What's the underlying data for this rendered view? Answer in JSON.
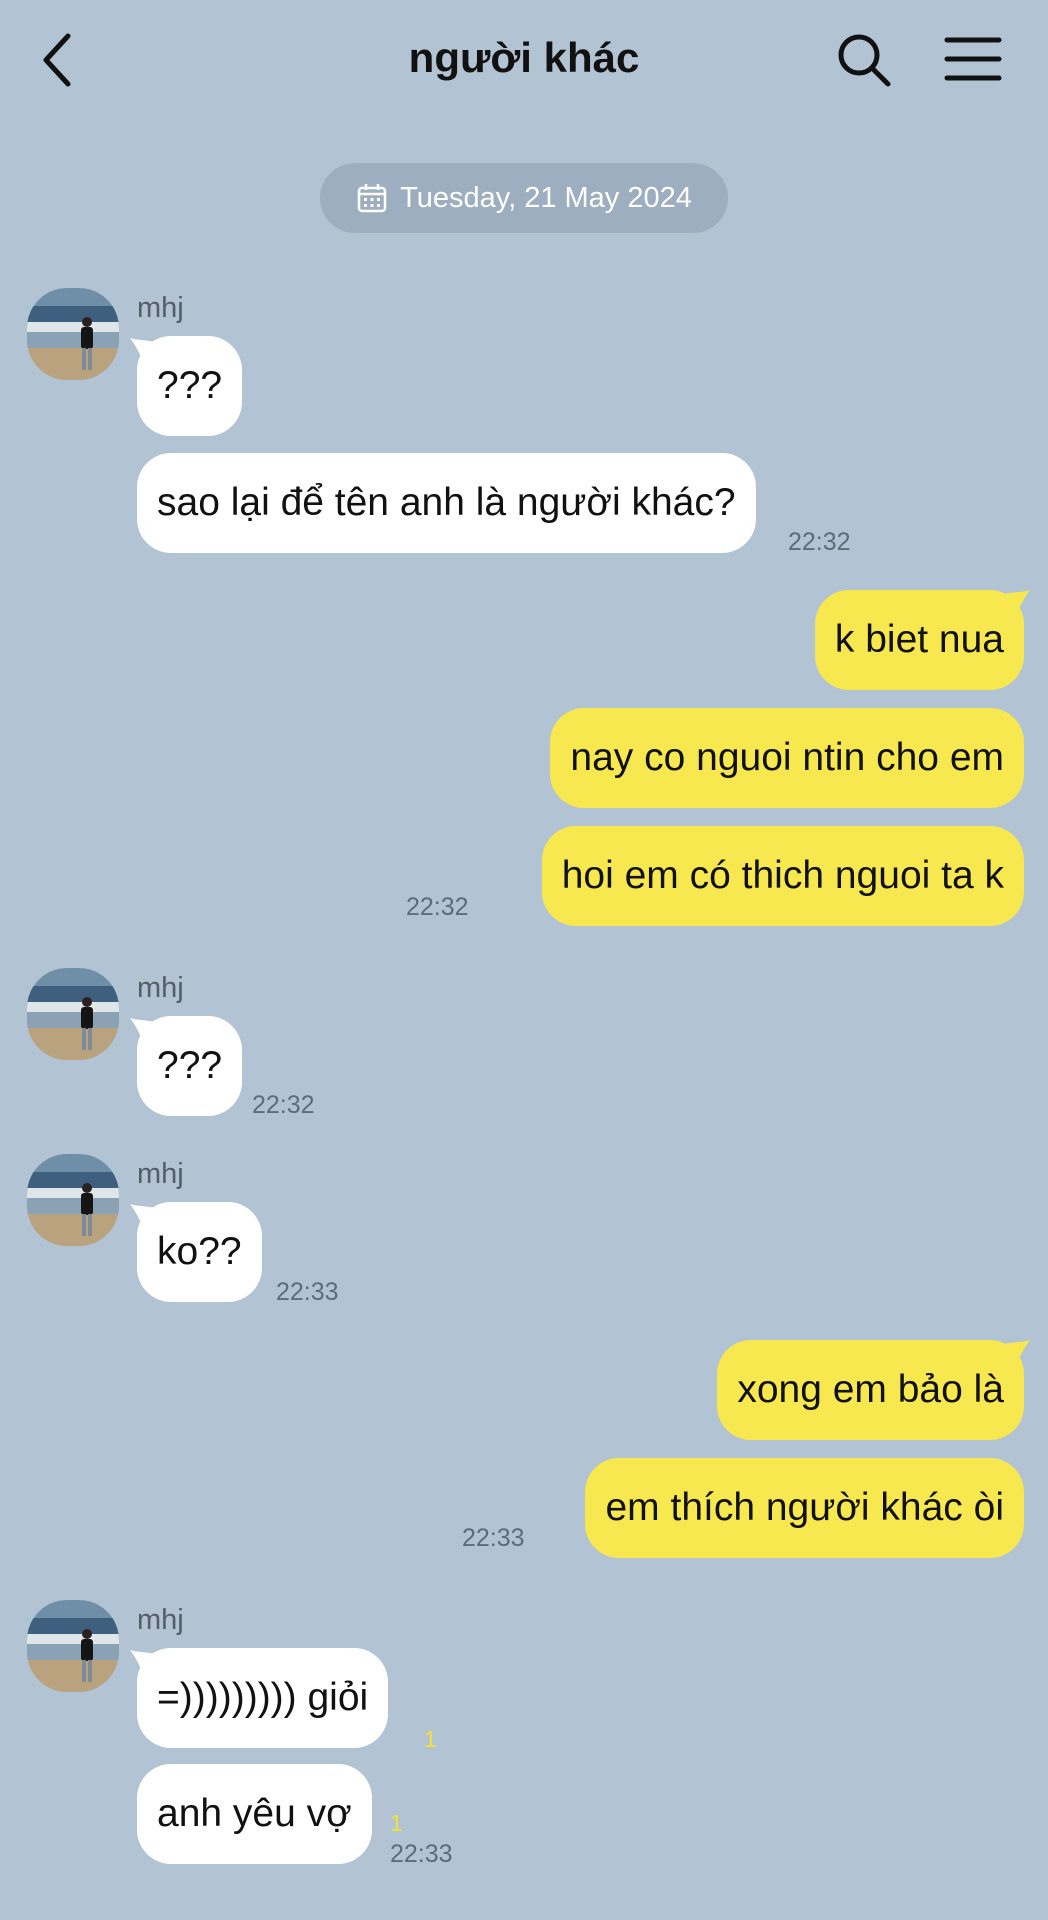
{
  "header": {
    "title": "người khác"
  },
  "date_divider": "Tuesday, 21 May 2024",
  "messages": [
    {
      "sender": "mhj",
      "text": "???"
    },
    {
      "text": "sao lại để tên anh là người khác?",
      "time": "22:32"
    },
    {
      "text": "k biet nua"
    },
    {
      "text": "nay co nguoi ntin cho em"
    },
    {
      "text": "hoi em có thich nguoi ta k",
      "time": "22:32"
    },
    {
      "sender": "mhj",
      "text": "???",
      "time": "22:32"
    },
    {
      "sender": "mhj",
      "text": "ko??",
      "time": "22:33"
    },
    {
      "text": "xong em bảo là"
    },
    {
      "text": "em thích người khác òi",
      "time": "22:33"
    },
    {
      "sender": "mhj",
      "text": "=))))))))) giỏi",
      "unread": "1"
    },
    {
      "text": "anh yêu vợ",
      "unread": "1",
      "time": "22:33"
    }
  ],
  "colors": {
    "background": "#b2c3d4",
    "incoming_bubble": "#ffffff",
    "outgoing_bubble": "#f8e84f",
    "unread_count": "#f4e23a"
  },
  "icons": [
    "back-arrow-icon",
    "search-icon",
    "menu-icon",
    "calendar-icon",
    "avatar-photo"
  ]
}
